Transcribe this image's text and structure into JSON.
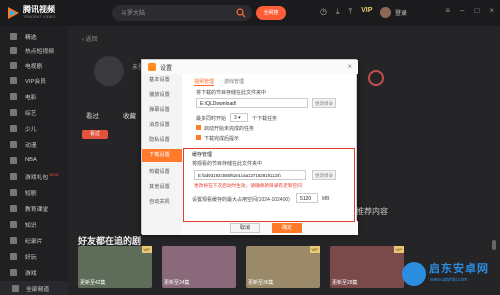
{
  "app": {
    "name": "腾讯视频",
    "slogan": "TENCENT VIDEO"
  },
  "topbar": {
    "search_text": "斗罗大陆",
    "hot_button": "全网搜",
    "vip": "VIP",
    "login": "登录"
  },
  "sidebar": {
    "items": [
      {
        "label": "精选"
      },
      {
        "label": "热点短视频"
      },
      {
        "label": "电视剧"
      },
      {
        "label": "VIP会员"
      },
      {
        "label": "电影"
      },
      {
        "label": "综艺"
      },
      {
        "label": "少儿"
      },
      {
        "label": "动漫"
      },
      {
        "label": "NBA"
      },
      {
        "label": "游戏礼包",
        "badge": "NEW"
      },
      {
        "label": "短剧"
      },
      {
        "label": "教育课堂"
      },
      {
        "label": "知识"
      },
      {
        "label": "纪录片"
      },
      {
        "label": "好玩"
      },
      {
        "label": "游戏"
      }
    ],
    "footer": "全部频道"
  },
  "main": {
    "back": "返回",
    "profile_name": "未登录",
    "watch_items": [
      "看过",
      "收藏"
    ],
    "tab_active": "看过",
    "recommend": "推荐内容",
    "section_title": "好友都在追的剧",
    "thumbs": [
      {
        "caption": "更新至42集",
        "vip": "VIP",
        "color": "#5e6d5a"
      },
      {
        "caption": "更新至24集",
        "vip": "",
        "color": "#8a6a7a"
      },
      {
        "caption": "更新至36集",
        "vip": "VIP",
        "color": "#9a8a6a"
      },
      {
        "caption": "更新至28集",
        "vip": "VIP",
        "color": "#7a4a4a"
      }
    ]
  },
  "dialog": {
    "title": "设置",
    "nav": [
      "基本设置",
      "播放设置",
      "弹幕设置",
      "消息设置",
      "隐私设置",
      "下载设置",
      "热键设置",
      "其他设置",
      "自动关机"
    ],
    "active_nav": "下载设置",
    "tabs": [
      "视频管理",
      "游戏管理"
    ],
    "download_path_label": "将下载的节目存储在此文件夹中",
    "download_path": "E:\\QLDownload\\",
    "change_dir_button": "更改目录",
    "concurrent_label_pre": "最多同时开始",
    "concurrent_value": "3",
    "concurrent_label_post": "个下载任务",
    "auto_start": "启动开始未完成的任务",
    "notify_done": "下载完成后提示",
    "cache_title": "缓存管理",
    "cache_label": "将观看的节目存储在此文件夹中",
    "cache_path": "E:\\bd93192c555f62e1caa1371828191124\\",
    "cache_change_button": "更改目录",
    "warn_text": "更改将在下次启动时生效，请确保新目录有足够空间",
    "cache_size_label": "设置观看缓存的最大占用空间(1024-102400)",
    "cache_size_value": "5120",
    "cache_size_unit": "MB",
    "cancel": "取消",
    "ok": "确定"
  },
  "watermark": {
    "cn": "启东安卓网",
    "en": "www.qdyhbj.com"
  }
}
